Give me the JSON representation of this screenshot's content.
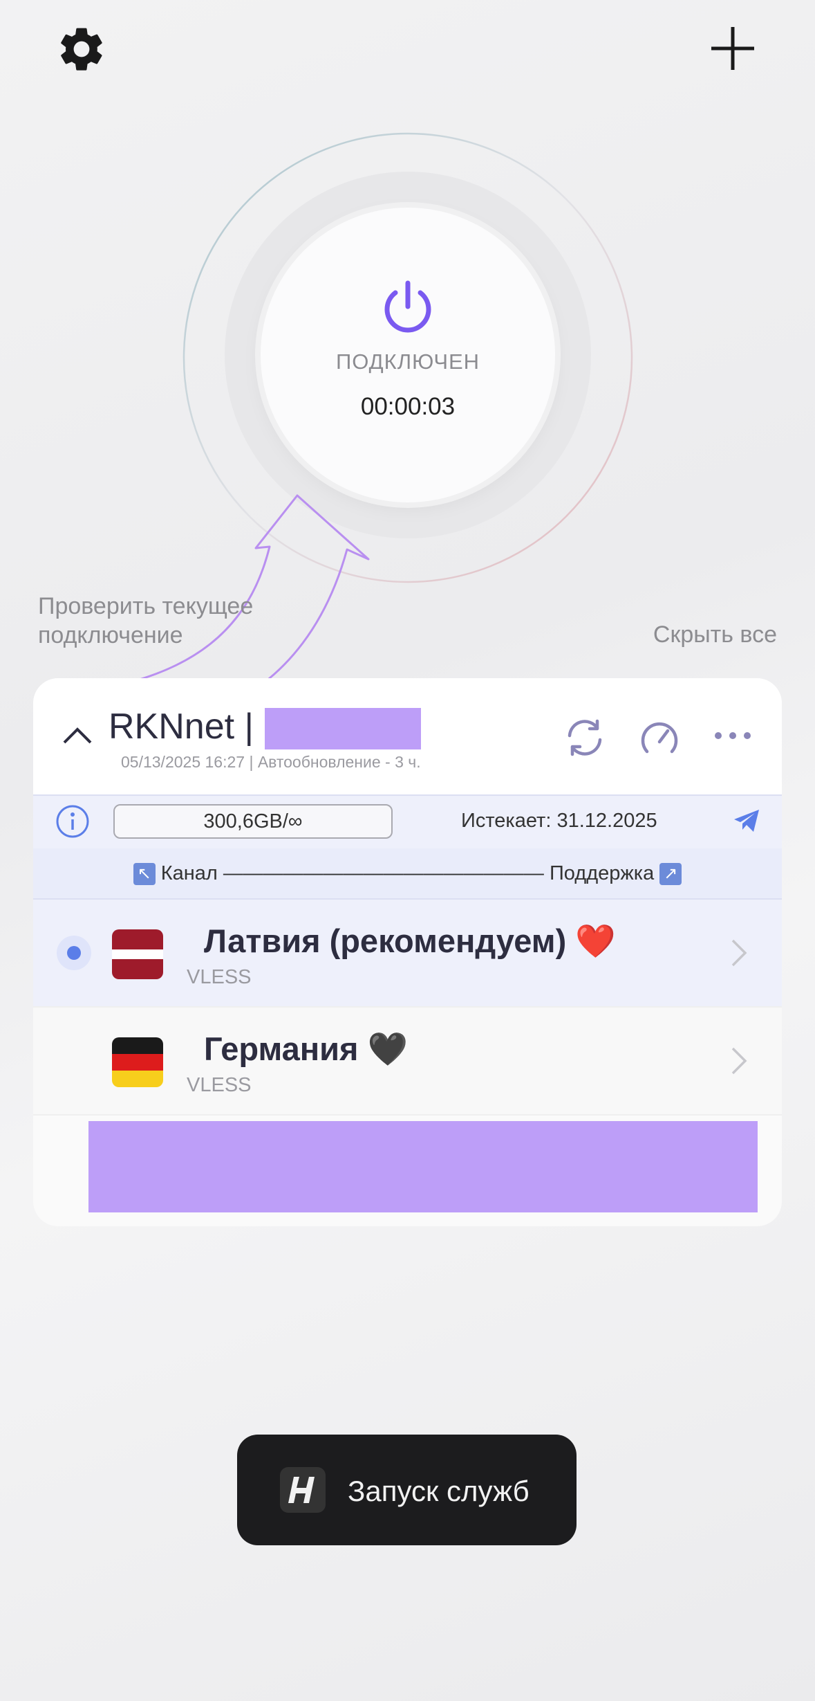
{
  "topbar": {
    "settings_icon": "gear-icon",
    "add_icon": "plus-icon"
  },
  "connection": {
    "power_icon": "power-icon",
    "status": "ПОДКЛЮЧЕН",
    "timer": "00:00:03",
    "accent_color": "#7a5af0"
  },
  "hint": {
    "line1": "Проверить текущее",
    "line2": "подключение"
  },
  "hide_all_label": "Скрыть все",
  "subscription": {
    "title": "RKNnet |",
    "meta": "05/13/2025 16:27 | Автообновление - 3 ч.",
    "traffic": "300,6GB/∞",
    "expires": "Истекает: 31.12.2025",
    "channel_label": "Канал",
    "dashes": "————————————————",
    "support_label": "Поддержка"
  },
  "servers": [
    {
      "name": "Латвия (рекомендуем) ❤️",
      "protocol": "VLESS",
      "selected": true,
      "flag": "latvia"
    },
    {
      "name": "Германия 🖤",
      "protocol": "VLESS",
      "selected": false,
      "flag": "germany"
    }
  ],
  "toast": {
    "text": "Запуск служб"
  }
}
